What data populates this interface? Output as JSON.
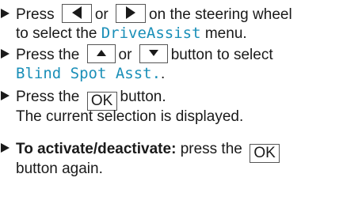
{
  "steps": [
    {
      "lines": [
        {
          "t1": "Press",
          "t2": "or",
          "t3": "on the steering wheel"
        },
        {
          "t1": "to select the",
          "display": "DriveAssist",
          "t2": "menu."
        }
      ],
      "keys": [
        "left-arrow-icon",
        "right-arrow-icon"
      ]
    },
    {
      "lines": [
        {
          "t1": "Press the",
          "t2": "or",
          "t3": "button to select"
        },
        {
          "display": "Blind Spot Asst.",
          "end": "."
        }
      ],
      "keys": [
        "up-arrow-icon",
        "down-arrow-icon"
      ]
    },
    {
      "lines": [
        {
          "t1": "Press the",
          "key": "OK",
          "t2": "button."
        },
        {
          "text": "The current selection is displayed."
        }
      ]
    },
    {
      "lines": [
        {
          "bold": "To activate/deactivate:",
          "t1": "press the",
          "key": "OK"
        },
        {
          "text": "button again."
        }
      ]
    }
  ],
  "colors": {
    "display_text": "#1a8fb8",
    "text": "#1a1a1a",
    "key_border": "#555555"
  }
}
